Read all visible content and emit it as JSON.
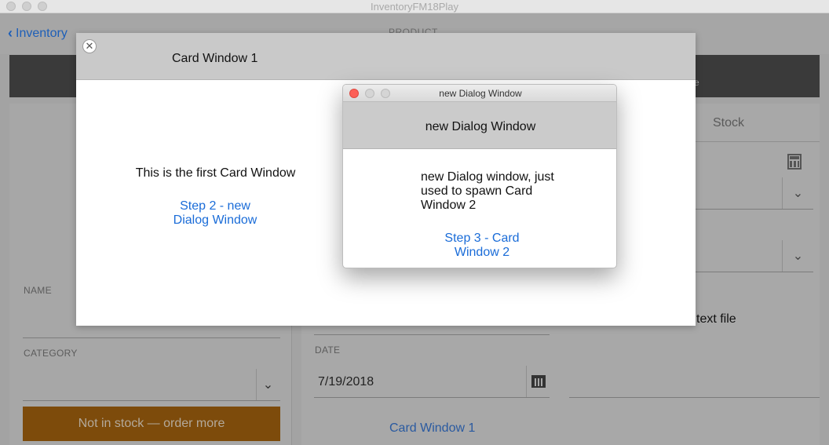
{
  "app": {
    "window_title": "InventoryFM18Play"
  },
  "nav": {
    "back_label": "Inventory",
    "title": "PRODUCT"
  },
  "toolbar": {
    "partial_text": "re"
  },
  "tabs": {
    "stock": "Stock"
  },
  "left_form": {
    "name_label": "NAME",
    "category_label": "CATEGORY",
    "order_button": "Not in stock — order more"
  },
  "right_form": {
    "date_label": "DATE",
    "date_value": "7/19/2018",
    "text_file": "text file",
    "card_link": "Card Window 1"
  },
  "card_window": {
    "title": "Card Window 1",
    "body_text": "This is the first Card Window",
    "step_link": "Step 2 - new Dialog Window"
  },
  "dialog": {
    "titlebar_title": "new Dialog Window",
    "header_title": "new Dialog Window",
    "body_text": "new Dialog window, just used to spawn Card Window 2",
    "step_link": "Step 3 - Card Window 2"
  }
}
